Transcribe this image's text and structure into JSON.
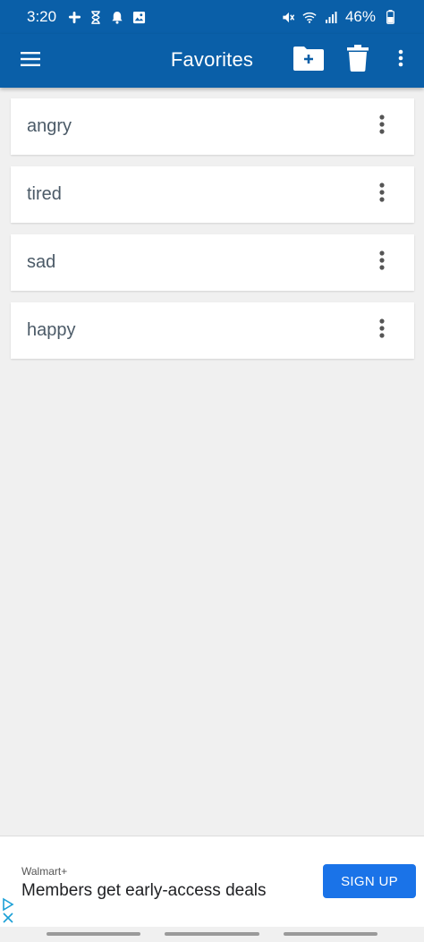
{
  "status_bar": {
    "time": "3:20",
    "battery": "46%",
    "icons_left": [
      "slack-icon",
      "hourglass-icon",
      "notification-bell-icon",
      "gallery-icon"
    ],
    "icons_right": [
      "mute-icon",
      "wifi-icon",
      "signal-icon",
      "battery-icon"
    ]
  },
  "app_bar": {
    "title": "Favorites",
    "menu_icon": "hamburger-menu-icon",
    "actions": [
      "add-folder-icon",
      "trash-icon",
      "more-vert-icon"
    ]
  },
  "favorites": {
    "items": [
      {
        "label": "angry"
      },
      {
        "label": "tired"
      },
      {
        "label": "sad"
      },
      {
        "label": "happy"
      }
    ]
  },
  "ad": {
    "brand": "Walmart+",
    "headline": "Members get early-access deals",
    "cta": "SIGN UP",
    "cta_color": "#1a73e8"
  },
  "colors": {
    "primary": "#0a5fa8",
    "background": "#f0f0f0",
    "item_text": "#4b5a67"
  }
}
